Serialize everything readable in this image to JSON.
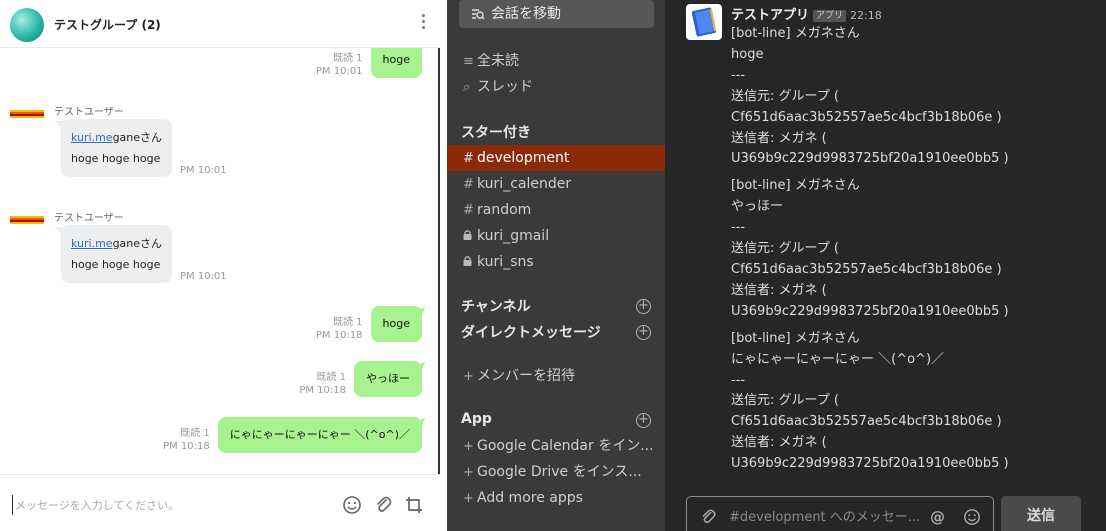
{
  "line": {
    "title": "テストグループ (2)",
    "messages": [
      {
        "type": "sent",
        "read": "既読 1",
        "time": "PM 10:01",
        "text": "hoge"
      },
      {
        "type": "recv",
        "name": "テストユーザー",
        "mention": "kuri.me",
        "mention_rest": "ganeさん",
        "text": "hoge hoge hoge",
        "time": "PM 10:01"
      },
      {
        "type": "recv",
        "name": "テストユーザー",
        "mention": "kuri.me",
        "mention_rest": "ganeさん",
        "text": "hoge hoge hoge",
        "time": "PM 10:01"
      },
      {
        "type": "sent",
        "read": "既読 1",
        "time": "PM 10:18",
        "text": "hoge"
      },
      {
        "type": "sent",
        "read": "既読 1",
        "time": "PM 10:18",
        "text": "やっほー"
      },
      {
        "type": "sent",
        "read": "既読 1",
        "time": "PM 10:18",
        "text": "にゃにゃーにゃーにゃー ＼(^o^)／"
      }
    ],
    "input_placeholder": "メッセージを入力してください。",
    "colors": {
      "sent_bubble": "#a6f38f",
      "recv_bubble": "#edeef0"
    }
  },
  "slack_sidebar": {
    "jump_label": "会話を移動",
    "all_unread": "全未読",
    "threads": "スレッド",
    "starred_heading": "スター付き",
    "starred": [
      {
        "prefix": "#",
        "name": "development",
        "active": true
      },
      {
        "prefix": "#",
        "name": "kuri_calender",
        "active": false
      },
      {
        "prefix": "#",
        "name": "random",
        "active": false
      },
      {
        "prefix": "🔒",
        "name": "kuri_gmail",
        "active": false
      },
      {
        "prefix": "🔒",
        "name": "kuri_sns",
        "active": false
      }
    ],
    "channels_heading": "チャンネル",
    "dm_heading": "ダイレクトメッセージ",
    "invite_label": "メンバーを招待",
    "app_heading": "App",
    "apps": [
      "Google Calendar をイン...",
      "Google Drive をインス...",
      "Add more apps"
    ],
    "colors": {
      "background": "#3a3a3a",
      "active": "#8a2a08"
    }
  },
  "slack_main": {
    "app_name": "テストアプリ",
    "app_badge": "アプリ",
    "time": "22:18",
    "messages": [
      [
        "[bot-line] メガネさん",
        "hoge",
        "---",
        "送信元: グループ (",
        "Cf651d6aac3b52557ae5c4bcf3b18b06e )",
        "送信者: メガネ (",
        "U369b9c229d9983725bf20a1910ee0bb5 )"
      ],
      [
        "[bot-line] メガネさん",
        "やっほー",
        "---",
        "送信元: グループ (",
        "Cf651d6aac3b52557ae5c4bcf3b18b06e )",
        "送信者: メガネ (",
        "U369b9c229d9983725bf20a1910ee0bb5 )"
      ],
      [
        "[bot-line] メガネさん",
        "にゃにゃーにゃーにゃー ＼(^o^)／",
        "---",
        "送信元: グループ (",
        "Cf651d6aac3b52557ae5c4bcf3b18b06e )",
        "送信者: メガネ (",
        "U369b9c229d9983725bf20a1910ee0bb5 )"
      ]
    ],
    "composer_placeholder": "#development へのメッセー...",
    "send_label": "送信"
  }
}
